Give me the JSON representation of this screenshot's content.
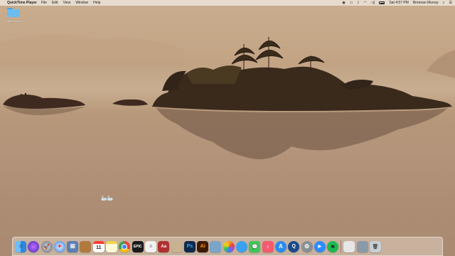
{
  "menubar": {
    "apple_icon": "apple-icon",
    "app_name": "QuickTime Player",
    "menus": [
      "File",
      "Edit",
      "View",
      "Window",
      "Help"
    ],
    "status_icons": [
      "screen-record-icon",
      "airplay-icon",
      "bluetooth-icon",
      "wifi-icon",
      "volume-icon",
      "battery-icon"
    ],
    "clock": "Sat 4:57 PM",
    "user": "Brennan Murray"
  },
  "desktop": {
    "folder_label": "untitled folder"
  },
  "dock": {
    "apps": [
      {
        "name": "finder-icon",
        "color": "#3b8fe5"
      },
      {
        "name": "siri-icon",
        "color": "#5b4bd8"
      },
      {
        "name": "launchpad-icon",
        "color": "#7a7f8a"
      },
      {
        "name": "safari-icon",
        "color": "#2b7de0"
      },
      {
        "name": "preview-icon",
        "color": "#5a7fb0"
      },
      {
        "name": "notes-brown-icon",
        "color": "#b07a3e"
      },
      {
        "name": "calendar-icon",
        "color": "#ffffff",
        "label": "11"
      },
      {
        "name": "notes-icon",
        "color": "#f2d54a"
      },
      {
        "name": "chrome-icon",
        "color": "#e8e8e8"
      },
      {
        "name": "epic-games-icon",
        "color": "#1a1a1a",
        "label": "EPIC"
      },
      {
        "name": "textedit-icon",
        "color": "#f0f0f0"
      },
      {
        "name": "dictionary-icon",
        "color": "#b03030",
        "label": "Aa"
      },
      {
        "name": "pages-icon",
        "color": "#c9b290"
      },
      {
        "name": "photoshop-icon",
        "color": "#0f2a4a",
        "label": "Ps"
      },
      {
        "name": "illustrator-icon",
        "color": "#3b1a05",
        "label": "Ai"
      },
      {
        "name": "preview-photos-icon",
        "color": "#7aa5c8"
      },
      {
        "name": "photos-icon",
        "color": "#ffffff"
      },
      {
        "name": "messages-blue-icon",
        "color": "#3aa0f0"
      },
      {
        "name": "messages-icon",
        "color": "#3ec65a"
      },
      {
        "name": "music-icon",
        "color": "#f55a6d"
      },
      {
        "name": "app-store-icon",
        "color": "#2a8bf2"
      },
      {
        "name": "quicktime-icon",
        "color": "#1a4a8a"
      },
      {
        "name": "system-preferences-icon",
        "color": "#8a8f96"
      },
      {
        "name": "zoom-icon",
        "color": "#2d8cff"
      },
      {
        "name": "spotify-icon",
        "color": "#1db954"
      },
      {
        "name": "document-icon",
        "color": "#e6e6e6"
      },
      {
        "name": "photo-stack-icon",
        "color": "#8a9aa8"
      },
      {
        "name": "trash-icon",
        "color": "#c9ced4"
      }
    ]
  }
}
